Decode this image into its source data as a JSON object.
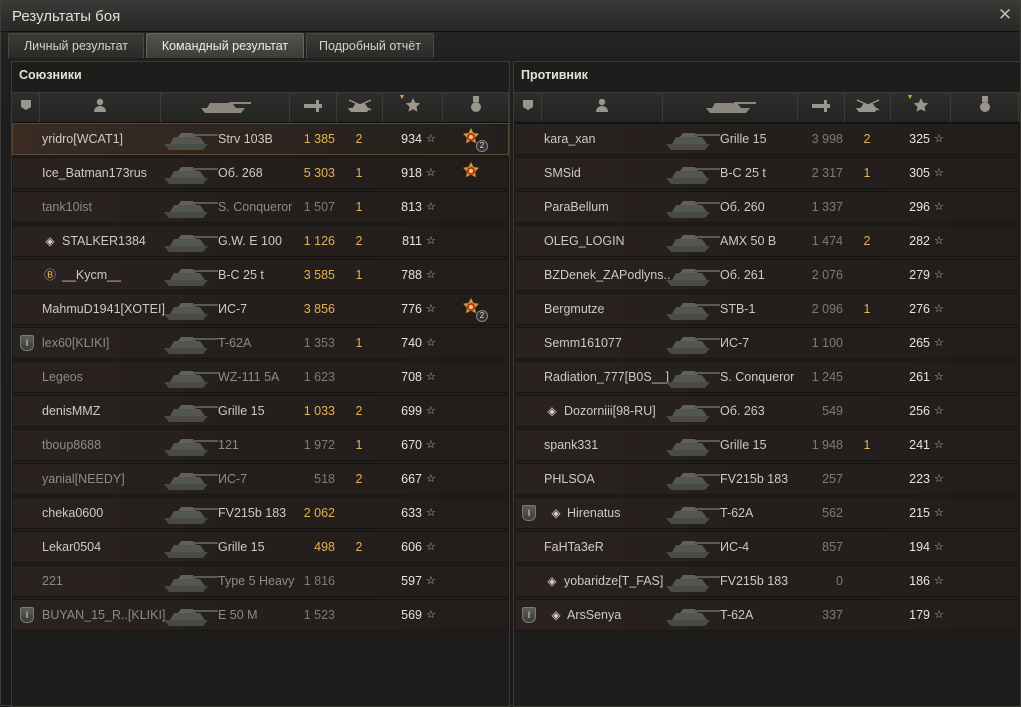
{
  "window": {
    "title": "Результаты боя",
    "close_icon": "close-icon"
  },
  "tabs": [
    {
      "label": "Личный результат",
      "active": false
    },
    {
      "label": "Командный результат",
      "active": true
    },
    {
      "label": "Подробный отчёт",
      "active": false
    }
  ],
  "allies": {
    "title": "Союзники",
    "rows": [
      {
        "name": "yridro[WCAT1]",
        "tank": "Strv 103B",
        "damage": "1 385",
        "dmg_hi": true,
        "frags": "2",
        "xp": "934",
        "medal": true,
        "medal_count": "2",
        "me": true,
        "badge": "",
        "rank": ""
      },
      {
        "name": "Ice_Batman173rus",
        "tank": "Об. 268",
        "damage": "5 303",
        "dmg_hi": true,
        "frags": "1",
        "xp": "918",
        "medal": true,
        "medal_count": "",
        "badge": "",
        "rank": ""
      },
      {
        "name": "tank10ist",
        "tank": "S. Conqueror",
        "damage": "1 507",
        "dmg_hi": false,
        "frags": "1",
        "xp": "813",
        "dead": true,
        "badge": "",
        "rank": ""
      },
      {
        "name": "STALKER1384",
        "tank": "G.W. E 100",
        "damage": "1 126",
        "dmg_hi": true,
        "frags": "2",
        "xp": "811",
        "badge": "",
        "rank": "diamond"
      },
      {
        "name": "__Kycm__",
        "tank": "B-C 25 t",
        "damage": "3 585",
        "dmg_hi": true,
        "frags": "1",
        "xp": "788",
        "badge": "",
        "rank": "gold"
      },
      {
        "name": "MahmuD1941[XOTEI]",
        "tank": "ИС-7",
        "damage": "3 856",
        "dmg_hi": true,
        "frags": "",
        "xp": "776",
        "medal": true,
        "medal_count": "2",
        "badge": "",
        "rank": ""
      },
      {
        "name": "lex60[KLIKI]",
        "tank": "T-62A",
        "damage": "1 353",
        "dmg_hi": false,
        "frags": "1",
        "xp": "740",
        "dead": true,
        "badge": "I",
        "rank": ""
      },
      {
        "name": "Legeos",
        "tank": "WZ-111 5A",
        "damage": "1 623",
        "dmg_hi": false,
        "frags": "",
        "xp": "708",
        "dead": true,
        "badge": "",
        "rank": ""
      },
      {
        "name": "denisMMZ",
        "tank": "Grille 15",
        "damage": "1 033",
        "dmg_hi": true,
        "frags": "2",
        "xp": "699",
        "badge": "",
        "rank": ""
      },
      {
        "name": "tboup8688",
        "tank": "121",
        "damage": "1 972",
        "dmg_hi": false,
        "frags": "1",
        "xp": "670",
        "dead": true,
        "badge": "",
        "rank": ""
      },
      {
        "name": "yanial[NEEDY]",
        "tank": "ИС-7",
        "damage": "518",
        "dmg_hi": false,
        "frags": "2",
        "xp": "667",
        "dead": true,
        "badge": "",
        "rank": ""
      },
      {
        "name": "cheka0600",
        "tank": "FV215b 183",
        "damage": "2 062",
        "dmg_hi": true,
        "frags": "",
        "xp": "633",
        "badge": "",
        "rank": ""
      },
      {
        "name": "Lekar0504",
        "tank": "Grille 15",
        "damage": "498",
        "dmg_hi": true,
        "frags": "2",
        "xp": "606",
        "badge": "",
        "rank": ""
      },
      {
        "name": "221",
        "tank": "Type 5 Heavy",
        "damage": "1 816",
        "dmg_hi": false,
        "frags": "",
        "xp": "597",
        "dead": true,
        "badge": "",
        "rank": ""
      },
      {
        "name": "BUYAN_15_R..[KLIKI]",
        "tank": "E 50 M",
        "damage": "1 523",
        "dmg_hi": false,
        "frags": "",
        "xp": "569",
        "dead": true,
        "badge": "I",
        "rank": ""
      }
    ]
  },
  "enemies": {
    "title": "Противник",
    "rows": [
      {
        "name": "kara_xan",
        "tank": "Grille 15",
        "damage": "3 998",
        "frags": "2",
        "xp": "325",
        "badge": "",
        "rank": ""
      },
      {
        "name": "SMSid",
        "tank": "B-C 25 t",
        "damage": "2 317",
        "frags": "1",
        "xp": "305",
        "badge": "",
        "rank": ""
      },
      {
        "name": "ParaBellum",
        "tank": "Об. 260",
        "damage": "1 337",
        "frags": "",
        "xp": "296",
        "badge": "",
        "rank": ""
      },
      {
        "name": "OLEG_LOGIN",
        "tank": "AMX 50 B",
        "damage": "1 474",
        "frags": "2",
        "xp": "282",
        "badge": "",
        "rank": ""
      },
      {
        "name": "BZDenek_ZAPodlyns..",
        "tank": "Об. 261",
        "damage": "2 076",
        "frags": "",
        "xp": "279",
        "badge": "",
        "rank": ""
      },
      {
        "name": "Bergmutze",
        "tank": "STB-1",
        "damage": "2 096",
        "frags": "1",
        "xp": "276",
        "badge": "",
        "rank": ""
      },
      {
        "name": "Semm161077",
        "tank": "ИС-7",
        "damage": "1 100",
        "frags": "",
        "xp": "265",
        "badge": "",
        "rank": ""
      },
      {
        "name": "Radiation_777[B0S__]",
        "tank": "S. Conqueror",
        "damage": "1 245",
        "frags": "",
        "xp": "261",
        "badge": "",
        "rank": ""
      },
      {
        "name": "Dozorniii[98-RU]",
        "tank": "Об. 263",
        "damage": "549",
        "frags": "",
        "xp": "256",
        "badge": "",
        "rank": "diamond"
      },
      {
        "name": "spank331",
        "tank": "Grille 15",
        "damage": "1 948",
        "frags": "1",
        "xp": "241",
        "badge": "",
        "rank": ""
      },
      {
        "name": "PHLSOA",
        "tank": "FV215b 183",
        "damage": "257",
        "frags": "",
        "xp": "223",
        "badge": "",
        "rank": ""
      },
      {
        "name": "Hirenatus",
        "tank": "T-62A",
        "damage": "562",
        "frags": "",
        "xp": "215",
        "badge": "I",
        "rank": "diamond"
      },
      {
        "name": "FaHTa3eR",
        "tank": "ИС-4",
        "damage": "857",
        "frags": "",
        "xp": "194",
        "badge": "",
        "rank": ""
      },
      {
        "name": "yobaridze[T_FAS]",
        "tank": "FV215b 183",
        "damage": "0",
        "frags": "",
        "xp": "186",
        "badge": "",
        "rank": "diamond"
      },
      {
        "name": "ArsSenya",
        "tank": "T-62A",
        "damage": "337",
        "frags": "",
        "xp": "179",
        "badge": "I",
        "rank": "diamond"
      }
    ]
  },
  "columns": [
    "platoon-icon",
    "player-icon",
    "tank-icon",
    "damage-icon",
    "frags-icon",
    "xp-icon",
    "medal-icon"
  ],
  "colors": {
    "accent": "#e4b152",
    "dead_text": "#8f8a82"
  }
}
